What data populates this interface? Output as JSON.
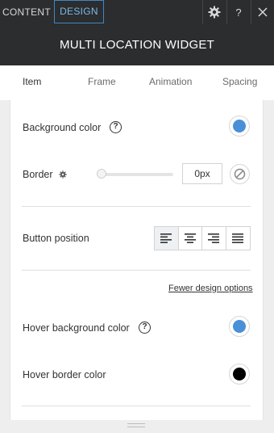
{
  "topbar": {
    "tab_content": "CONTENT",
    "tab_design": "DESIGN",
    "help_glyph": "?",
    "icons": [
      "gear-icon",
      "help-icon",
      "close-icon"
    ]
  },
  "header": {
    "title": "MULTI LOCATION WIDGET"
  },
  "tabs": [
    {
      "label": "Item"
    },
    {
      "label": "Frame"
    },
    {
      "label": "Animation"
    },
    {
      "label": "Spacing"
    }
  ],
  "settings": {
    "background_color_label": "Background color",
    "background_color_value": "#4a90d9",
    "border_label": "Border",
    "border_value": "0px",
    "button_position_label": "Button position",
    "button_position_selected": "left",
    "fewer_options_link": "Fewer design options",
    "hover_background_color_label": "Hover background color",
    "hover_background_color_value": "#4a90d9",
    "hover_border_color_label": "Hover border color",
    "hover_border_color_value": "#000000"
  },
  "help_glyph": "?",
  "colors": {
    "accent": "#3f87c4",
    "dark_bar": "#2b2d2f"
  }
}
